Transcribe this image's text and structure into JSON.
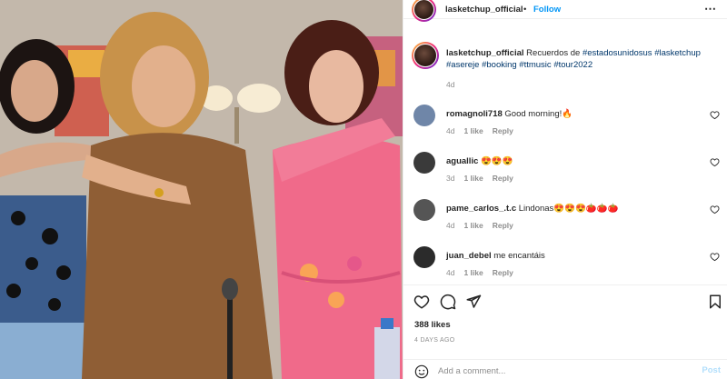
{
  "header": {
    "username": "lasketchup_official",
    "separator": "•",
    "follow_label": "Follow",
    "more_icon": "more-horizontal-icon"
  },
  "caption": {
    "username": "lasketchup_official",
    "text_plain": "Recuerdos de",
    "hashtags": [
      "#estadosunidosus",
      "#lasketchup",
      "#asereje",
      "#booking",
      "#ttmusic",
      "#tour2022"
    ],
    "time": "4d"
  },
  "comments": [
    {
      "username": "romagnoli718",
      "text": "Good morning!🔥",
      "time": "4d",
      "likes": "1 like",
      "reply": "Reply",
      "avatar_color": "#6f86a8"
    },
    {
      "username": "aguallic",
      "text": "😍😍😍",
      "time": "3d",
      "likes": "1 like",
      "reply": "Reply",
      "avatar_color": "#3a3a3a"
    },
    {
      "username": "pame_carlos_.t.c",
      "text": "Lindonas😍😍😍🍅🍅🍅",
      "time": "4d",
      "likes": "1 like",
      "reply": "Reply",
      "avatar_color": "#555555"
    },
    {
      "username": "juan_debel",
      "text": "me encantáis",
      "time": "4d",
      "likes": "1 like",
      "reply": "Reply",
      "avatar_color": "#2b2b2b"
    }
  ],
  "actions": {
    "like_icon": "heart-outline-icon",
    "comment_icon": "comment-bubble-icon",
    "share_icon": "paper-plane-icon",
    "save_icon": "bookmark-icon"
  },
  "likes_count": "388 likes",
  "post_date": "4 DAYS AGO",
  "add_comment": {
    "placeholder": "Add a comment...",
    "post_label": "Post",
    "emoji_icon": "smiley-icon"
  },
  "colors": {
    "link_blue": "#0095f6",
    "hashtag": "#00376b",
    "muted": "#8e8e8e",
    "post_disabled": "#b2dffc"
  }
}
